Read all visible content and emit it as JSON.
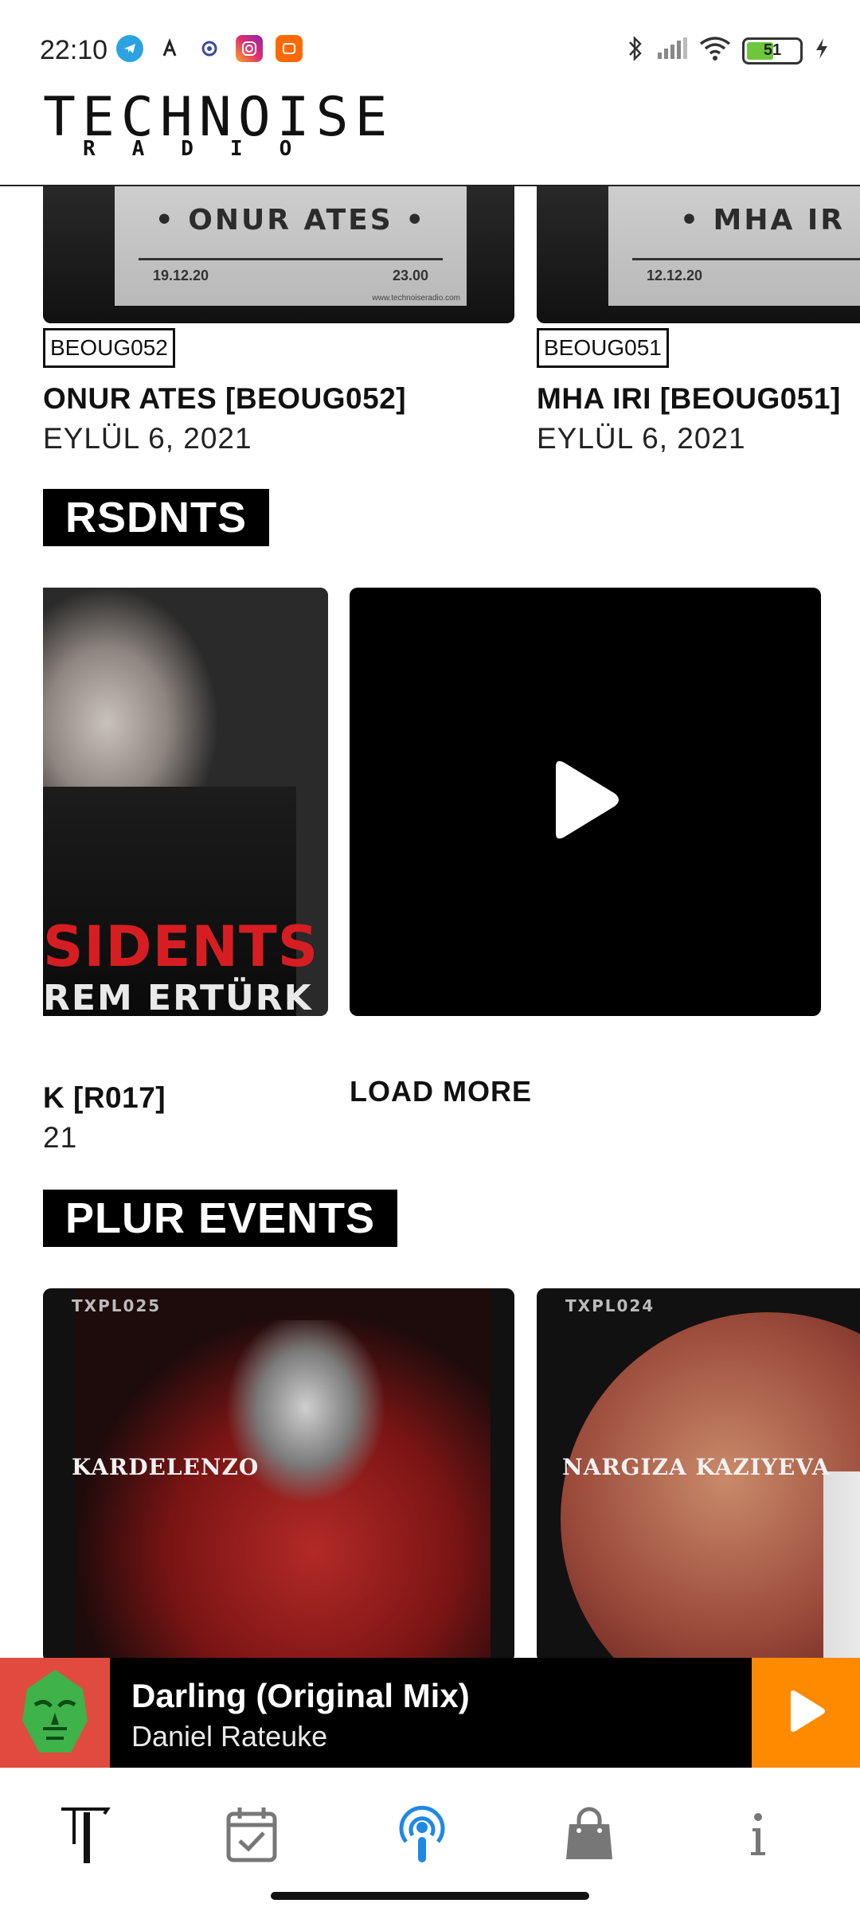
{
  "status_bar": {
    "time": "22:10",
    "battery": "51",
    "battery_level": 0.51,
    "icons": [
      "telegram-icon",
      "app-icon",
      "settings-app-icon",
      "instagram-icon",
      "mi-icon",
      "bluetooth-icon",
      "signal-icon",
      "wifi-icon",
      "charging-icon"
    ]
  },
  "header": {
    "logo_main": "TECHNOISE",
    "logo_sub": "RADIO"
  },
  "releases": {
    "items": [
      {
        "poster_name": "• ONUR ATES •",
        "poster_date": "19.12.20",
        "poster_time": "23.00",
        "poster_url": "www.technoiseradio.com",
        "code": "BEOUG052",
        "title": "ONUR ATES [BEOUG052]",
        "date": "EYLÜL 6, 2021"
      },
      {
        "poster_name": "• MHA IR",
        "poster_date": "12.12.20",
        "code": "BEOUG051",
        "title": "MHA IRI [BEOUG051]",
        "date": "EYLÜL 6, 2021"
      }
    ]
  },
  "residents": {
    "section_title": "RSDNTS",
    "card_red_text": "SIDENTS",
    "card_white_text": "REM ERTÜRK",
    "card_title": "K [R017]",
    "card_date": "21",
    "load_more": "LOAD MORE"
  },
  "events": {
    "section_title": "PLUR EVENTS",
    "items": [
      {
        "code": "TXPL025",
        "name": "KARDELENZO"
      },
      {
        "code": "TXPL024",
        "name": "NARGIZA KAZIYEVA"
      }
    ]
  },
  "now_playing": {
    "title": "Darling (Original Mix)",
    "artist": "Daniel Rateuke"
  },
  "bottom_nav": {
    "items": [
      "home-logo-icon",
      "calendar-check-icon",
      "podcast-icon",
      "shopping-bag-icon",
      "info-icon"
    ],
    "active_index": 2,
    "accent": "#1e88e5"
  },
  "colors": {
    "play_button": "#ff8a00",
    "artwork_bg": "#e14a3e"
  }
}
